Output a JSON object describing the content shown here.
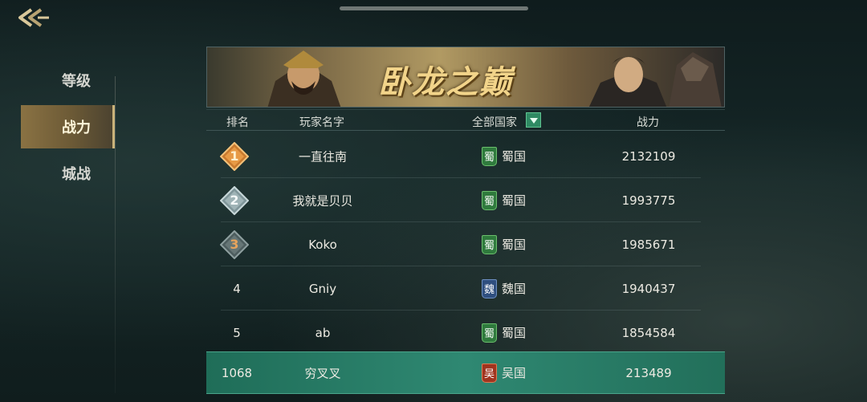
{
  "nav": {
    "back_icon": "back-arrow-icon"
  },
  "sidebar": {
    "tabs": [
      {
        "label": "等级",
        "active": false
      },
      {
        "label": "战力",
        "active": true
      },
      {
        "label": "城战",
        "active": false
      }
    ]
  },
  "banner": {
    "title": "卧龙之巅"
  },
  "table": {
    "headers": {
      "rank": "排名",
      "name": "玩家名字",
      "country_filter": "全部国家",
      "power": "战力"
    },
    "rows": [
      {
        "rank": "1",
        "name": "一直往南",
        "flag": "蜀",
        "nation": "蜀国",
        "power": "2132109",
        "medal": "gold"
      },
      {
        "rank": "2",
        "name": "我就是贝贝",
        "flag": "蜀",
        "nation": "蜀国",
        "power": "1993775",
        "medal": "silver"
      },
      {
        "rank": "3",
        "name": "Koko",
        "flag": "蜀",
        "nation": "蜀国",
        "power": "1985671",
        "medal": "bronze"
      },
      {
        "rank": "4",
        "name": "Gniy",
        "flag": "魏",
        "nation": "魏国",
        "power": "1940437",
        "medal": ""
      },
      {
        "rank": "5",
        "name": "ab",
        "flag": "蜀",
        "nation": "蜀国",
        "power": "1854584",
        "medal": ""
      }
    ],
    "self_row": {
      "rank": "1068",
      "name": "穷叉叉",
      "flag": "吴",
      "nation": "吴国",
      "power": "213489"
    }
  },
  "colors": {
    "accent_gold": "#c9b27a",
    "self_row": "#2f8872",
    "shu": "#2f7a3d",
    "wei": "#2f4f7f",
    "wu": "#a0341f"
  }
}
